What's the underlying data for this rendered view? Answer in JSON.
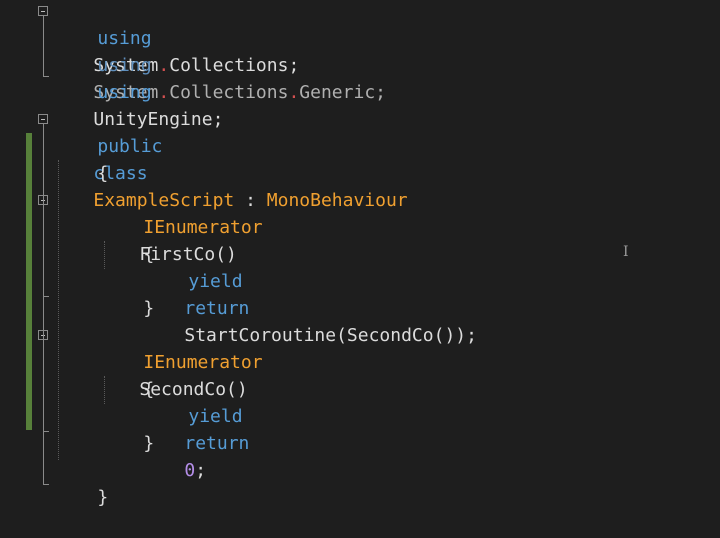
{
  "code": {
    "line1": {
      "kw": "using",
      "a": "System",
      "dot1": ".",
      "b": "Collections",
      "end": ";"
    },
    "line2": {
      "kw": "using",
      "a": "System",
      "dot1": ".",
      "b": "Collections",
      "dot2": ".",
      "c": "Generic",
      "end": ";"
    },
    "line3": {
      "kw": "using",
      "a": "UnityEngine;"
    },
    "line5": {
      "kw1": "public",
      "kw2": "class",
      "name": "ExampleScript",
      "colon": " : ",
      "base": "MonoBehaviour"
    },
    "line6": "{",
    "line8": {
      "type": "IEnumerator",
      "name": "FirstCo()"
    },
    "line9": "{",
    "line10": {
      "kw1": "yield",
      "kw2": "return",
      "call": "StartCoroutine(SecondCo());"
    },
    "line11": "}",
    "line13": {
      "type": "IEnumerator",
      "name": "SecondCo()"
    },
    "line14": "{",
    "line15": {
      "kw1": "yield",
      "kw2": "return",
      "num": "0",
      "end": ";"
    },
    "line16": "}",
    "line18": "}"
  },
  "cursor_glyph": "I",
  "colors": {
    "background": "#1e1e1e",
    "keyword": "#569cd6",
    "type": "#f0a030",
    "number": "#b48ee8",
    "text": "#dcdcdc",
    "change_bar": "#57803a"
  }
}
